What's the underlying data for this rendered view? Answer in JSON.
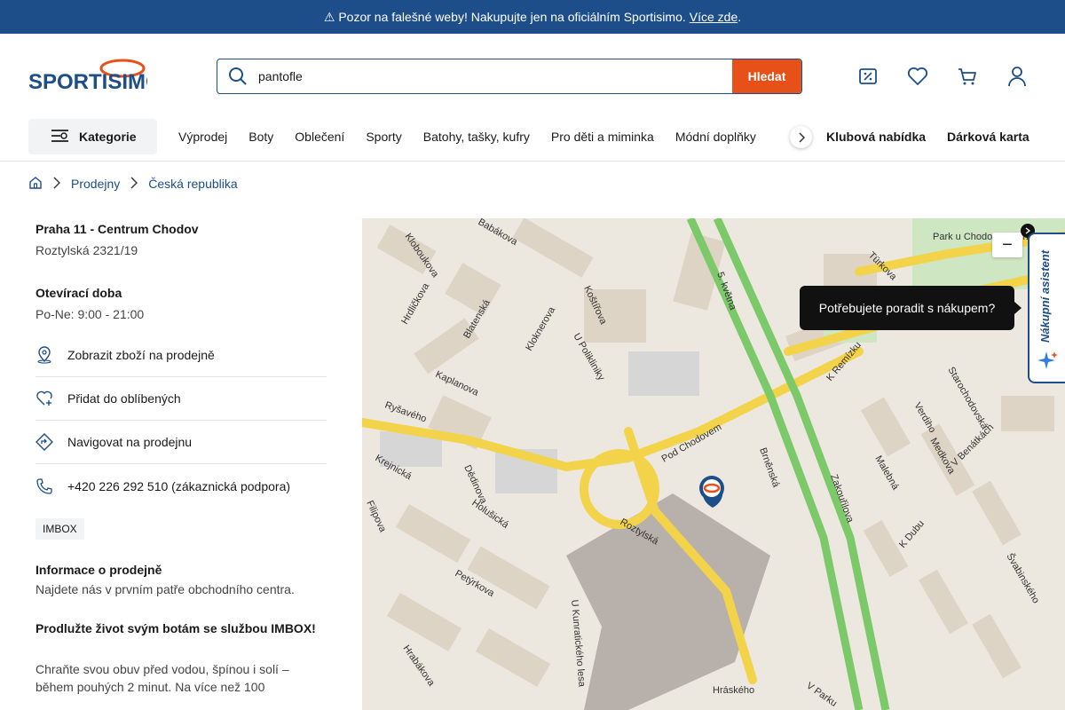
{
  "banner": {
    "text": "⚠ Pozor na falešné weby! Nakupujte jen na oficiálním Sportisimo.",
    "link": "Více zde",
    "suffix": "."
  },
  "brand": {
    "name": "SPORTISIMO",
    "color": "#1d4e89",
    "accent": "#e8501a"
  },
  "search": {
    "value": "pantofle",
    "button": "Hledat"
  },
  "header_icons": [
    "percent-tag-icon",
    "heart-icon",
    "cart-icon",
    "user-icon"
  ],
  "nav": {
    "categories": "Kategorie",
    "items": [
      "Výprodej",
      "Boty",
      "Oblečení",
      "Sporty",
      "Batohy, tašky, kufry",
      "Pro děti a miminka",
      "Módní doplňky"
    ],
    "highlights": [
      "Klubová nabídka",
      "Dárková karta"
    ]
  },
  "breadcrumb": [
    "Prodejny",
    "Česká republika"
  ],
  "store": {
    "name": "Praha 11 - Centrum Chodov",
    "address": "Roztylská 2321/19",
    "hours_title": "Otevírací doba",
    "hours": "Po-Ne: 9:00 - 21:00",
    "actions": [
      {
        "icon": "location-pin-icon",
        "label": "Zobrazit zboží na prodejně"
      },
      {
        "icon": "heart-plus-icon",
        "label": "Přidat do oblíbených"
      },
      {
        "icon": "navigate-icon",
        "label": "Navigovat na prodejnu"
      },
      {
        "icon": "phone-icon",
        "label": "+420 226 292 510 (zákaznická podpora)"
      }
    ],
    "tag": "IMBOX",
    "info_title": "Informace o prodejně",
    "info_text": "Najdete nás v prvním patře obchodního centra.",
    "promo_title": "Prodlužte život svým botám se službou IMBOX!",
    "promo_text": "Chraňte svou obuv před vodou, špínou i solí – během pouhých 2 minut. Na více než 100"
  },
  "map": {
    "streets": [
      "Kloboukova",
      "Babákova",
      "Hrdličkova",
      "Blatenská",
      "Koštířova",
      "Kloknerova",
      "U Polikliniky",
      "Kaplanova",
      "Ryšavého",
      "Pod Chodovem",
      "Brněnská",
      "Krejnická",
      "Dědinova",
      "Holušická",
      "Roztylská",
      "Filipova",
      "Petýrkova",
      "Hrabákova",
      "U Kunratického lesa",
      "Hráského",
      "Türkova",
      "K Remízku",
      "Starochodovská",
      "Verdiho",
      "Medkova",
      "Malebná",
      "Zakouřilova",
      "K Dubu",
      "V Benátkách",
      "Švabinského",
      "V Parku",
      "Park u Chodovské tvrze",
      "5. května"
    ],
    "zoom_out": "−"
  },
  "assistant": {
    "label": "Nákupní asistent",
    "tooltip": "Potřebujete poradit s nákupem?"
  }
}
